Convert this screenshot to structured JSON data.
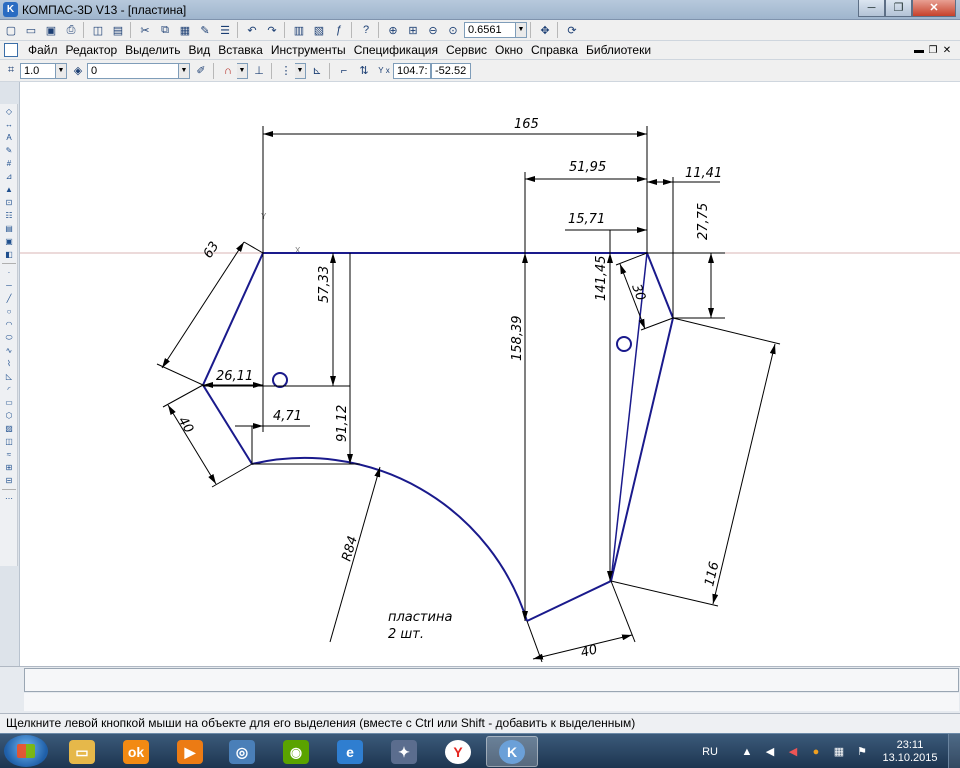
{
  "window": {
    "title": "КОМПАС-3D V13 - [пластина]",
    "icon_letter": "K",
    "minimize": "─",
    "maximize": "❐",
    "close": "✕"
  },
  "toolbar1": {
    "zoom_value": "0.6561"
  },
  "menu": {
    "items": [
      "Файл",
      "Редактор",
      "Выделить",
      "Вид",
      "Вставка",
      "Инструменты",
      "Спецификация",
      "Сервис",
      "Окно",
      "Справка",
      "Библиотеки"
    ],
    "mdi_minimize": "▬",
    "mdi_restore": "❐",
    "mdi_close": "✕"
  },
  "toolbar3": {
    "line_scale": "1.0",
    "layer": "0",
    "coord_x": "104.7:",
    "coord_y": "-52.52"
  },
  "drawing": {
    "dim_165": "165",
    "dim_51_95": "51,95",
    "dim_11_41": "11,41",
    "dim_15_71": "15,71",
    "dim_27_75": "27,75",
    "dim_63": "63",
    "dim_57_33": "57,33",
    "dim_158_39": "158,39",
    "dim_141_45": "141,45",
    "dim_30": "30",
    "dim_26_11": "26,11",
    "dim_4_71": "4,71",
    "dim_40_left": "40",
    "dim_91_12": "91,12",
    "dim_R84": "R84",
    "dim_116": "116",
    "dim_40_bottom": "40",
    "note_line1": "пластина",
    "note_line2": "2 шт.",
    "axis_x": "X",
    "axis_y": "Y"
  },
  "status": {
    "hint": "Щелкните левой кнопкой мыши на объекте для его выделения (вместе с Ctrl или Shift - добавить к выделенным)"
  },
  "taskbar": {
    "lang": "RU",
    "time": "23:11",
    "date": "13.10.2015"
  },
  "colors": {
    "contour": "#1a1a8c",
    "dimension": "#000000",
    "axis": "#c9a0a0"
  }
}
